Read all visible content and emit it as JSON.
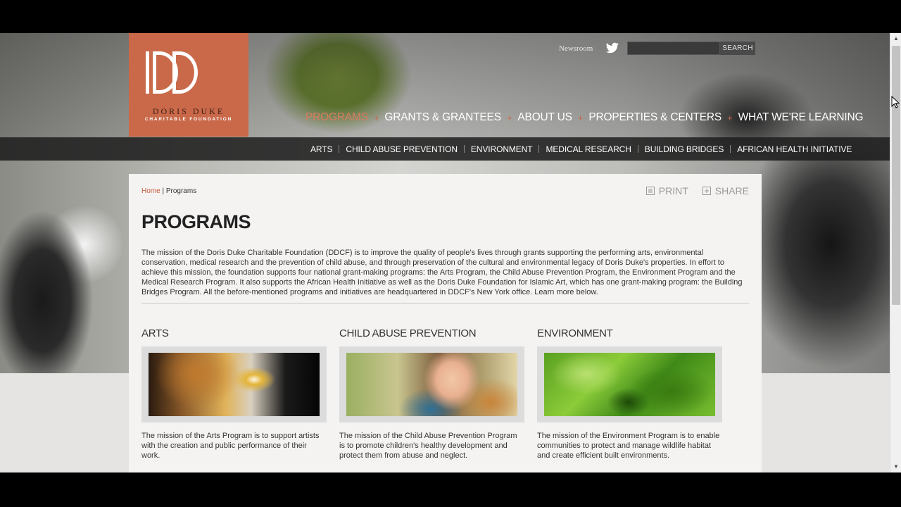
{
  "logo": {
    "mark": "DD",
    "name": "DORIS DUKE",
    "subtitle": "CHARITABLE FOUNDATION",
    "color": "#c9694a"
  },
  "utility": {
    "newsroom": "Newsroom",
    "twitter_icon": "twitter-icon",
    "search_placeholder": "",
    "search_button": "SEARCH"
  },
  "main_nav": {
    "items": [
      {
        "label": "PROGRAMS",
        "active": true
      },
      {
        "label": "GRANTS & GRANTEES",
        "active": false
      },
      {
        "label": "ABOUT US",
        "active": false
      },
      {
        "label": "PROPERTIES & CENTERS",
        "active": false
      },
      {
        "label": "WHAT WE'RE LEARNING",
        "active": false
      }
    ],
    "separator": "+"
  },
  "sub_nav": {
    "items": [
      "ARTS",
      "CHILD ABUSE PREVENTION",
      "ENVIRONMENT",
      "MEDICAL RESEARCH",
      "BUILDING BRIDGES",
      "AFRICAN HEALTH INITIATIVE"
    ]
  },
  "content": {
    "breadcrumb": {
      "home": "Home",
      "sep": " | ",
      "current": "Programs"
    },
    "tools": {
      "print": "PRINT",
      "share": "SHARE"
    },
    "title": "PROGRAMS",
    "intro": "The mission of the Doris Duke Charitable Foundation (DDCF) is to improve the quality of people's lives through grants supporting the performing arts, environmental conservation, medical research and the prevention of child abuse, and through preservation of the cultural and environmental legacy of Doris Duke's properties. In effort to achieve this mission, the foundation supports four national grant-making programs: the Arts Program, the Child Abuse Prevention Program, the Environment Program and the Medical Research Program. It also supports the African Health Initiative as well as the Doris Duke Foundation for Islamic Art, which has one grant-making program: the Building Bridges Program. All the before-mentioned programs and initiatives are headquartered in DDCF's New York office. Learn more below.",
    "programs": [
      {
        "title": "ARTS",
        "description": "The mission of the Arts Program is to support artists with the creation and public performance of their work."
      },
      {
        "title": "CHILD ABUSE PREVENTION",
        "description": "The mission of the Child Abuse Prevention Program is to promote children's healthy development and protect them from abuse and neglect."
      },
      {
        "title": "ENVIRONMENT",
        "description": "The mission of the Environment Program is to enable communities to protect and manage wildlife habitat and create efficient built environments."
      }
    ]
  },
  "colors": {
    "accent": "#c5573a",
    "nav_active": "#d97d5e",
    "subnav_bg": "#1e1e1e"
  }
}
